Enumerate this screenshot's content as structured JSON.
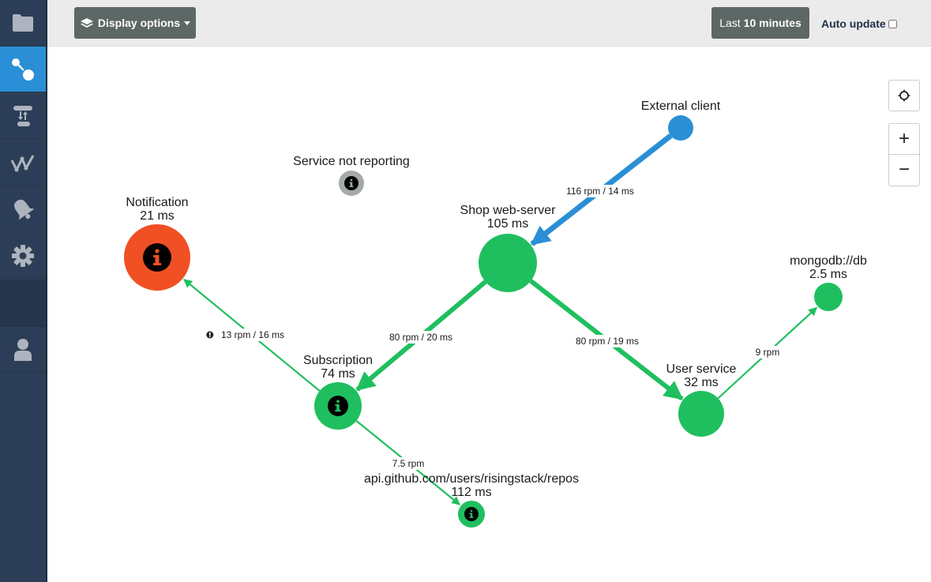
{
  "sidebar": {
    "items": [
      {
        "name": "folder-icon",
        "label": "Projects",
        "active": false
      },
      {
        "name": "topology-icon",
        "label": "Topology",
        "active": true
      },
      {
        "name": "transfer-icon",
        "label": "Services",
        "active": false
      },
      {
        "name": "metrics-icon",
        "label": "Metrics",
        "active": false
      },
      {
        "name": "bell-icon",
        "label": "Alerts",
        "active": false
      },
      {
        "name": "gear-icon",
        "label": "Settings",
        "active": false
      },
      {
        "name": "user-icon",
        "label": "Profile",
        "active": false
      }
    ]
  },
  "toolbar": {
    "display_options_label": "Display options",
    "time_range_prefix": "Last",
    "time_range_value": "10 minutes",
    "auto_update_label": "Auto update",
    "auto_update_checked": false
  },
  "map_controls": {
    "center_label": "center",
    "zoom_in_label": "+",
    "zoom_out_label": "−"
  },
  "colors": {
    "healthy": "#1fbf5f",
    "error": "#f05024",
    "external": "#2a8fd6",
    "inactive": "#a5a9aa",
    "sidebar_bg": "#2c3e57",
    "active_tab": "#2a8fd6"
  },
  "graph": {
    "nodes": [
      {
        "id": "external",
        "name": "External client",
        "latency": "",
        "status": "external",
        "info": false
      },
      {
        "id": "notreporting",
        "name": "Service not reporting",
        "latency": "",
        "status": "inactive",
        "info": true
      },
      {
        "id": "notification",
        "name": "Notification",
        "latency": "21 ms",
        "status": "error",
        "info": true
      },
      {
        "id": "shop",
        "name": "Shop web-server",
        "latency": "105 ms",
        "status": "healthy",
        "info": false
      },
      {
        "id": "mongodb",
        "name": "mongodb://db",
        "latency": "2.5 ms",
        "status": "healthy",
        "info": false
      },
      {
        "id": "subscription",
        "name": "Subscription",
        "latency": "74 ms",
        "status": "healthy",
        "info": true
      },
      {
        "id": "user",
        "name": "User service",
        "latency": "32 ms",
        "status": "healthy",
        "info": false
      },
      {
        "id": "github",
        "name": "api.github.com/users/risingstack/repos",
        "latency": "112 ms",
        "status": "healthy",
        "info": true
      }
    ],
    "edges": [
      {
        "from": "external",
        "to": "shop",
        "label": "116 rpm / 14 ms",
        "rpm": 116,
        "warning": false
      },
      {
        "from": "shop",
        "to": "subscription",
        "label": "80 rpm / 20 ms",
        "rpm": 80,
        "warning": false
      },
      {
        "from": "shop",
        "to": "user",
        "label": "80 rpm / 19 ms",
        "rpm": 80,
        "warning": false
      },
      {
        "from": "subscription",
        "to": "notification",
        "label": "13 rpm / 16 ms",
        "rpm": 13,
        "warning": true
      },
      {
        "from": "subscription",
        "to": "github",
        "label": "7.5 rpm",
        "rpm": 7.5,
        "warning": false
      },
      {
        "from": "user",
        "to": "mongodb",
        "label": "9 rpm",
        "rpm": 9,
        "warning": false
      }
    ]
  }
}
